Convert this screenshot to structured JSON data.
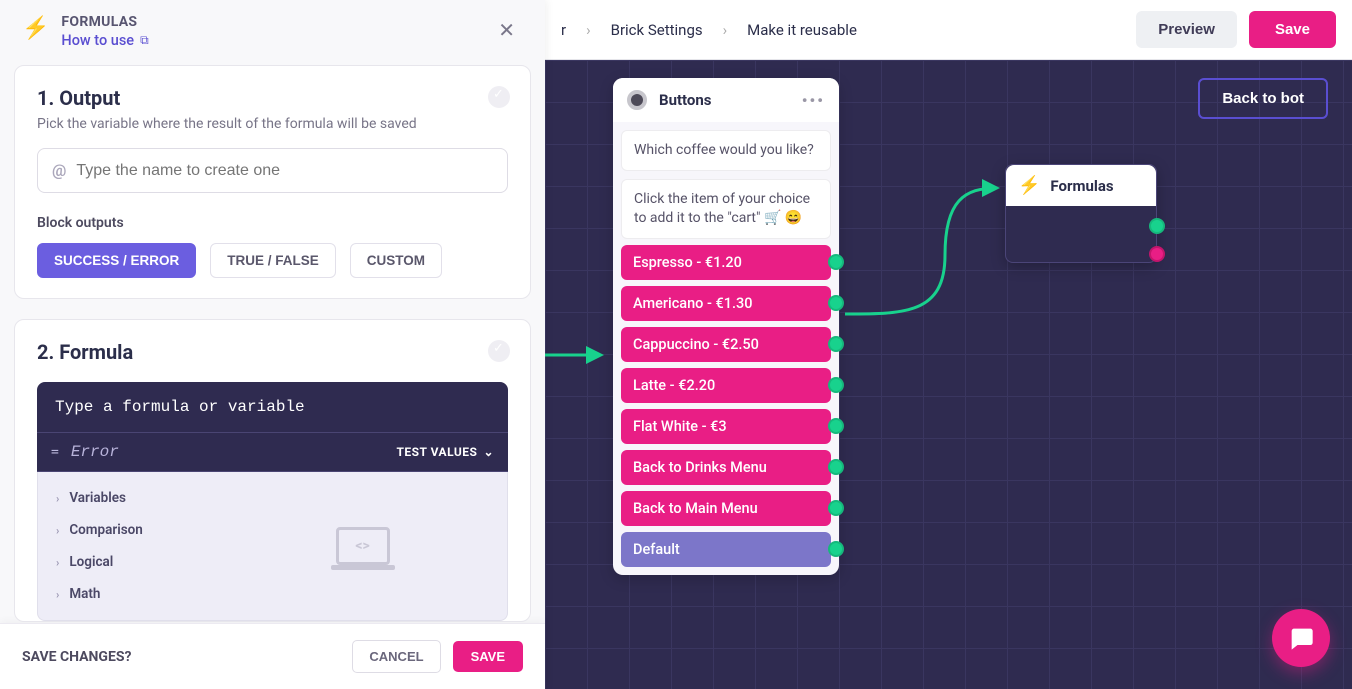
{
  "topbar": {
    "breadcrumb": [
      "r",
      "Brick Settings",
      "Make it reusable"
    ],
    "preview": "Preview",
    "save": "Save"
  },
  "canvas": {
    "back_to_bot": "Back to bot",
    "buttons_node": {
      "title": "Buttons",
      "msg1": "Which coffee would you like?",
      "msg2": "Click the item of your choice to add it to the \"cart\" 🛒 😄",
      "options": [
        "Espresso - €1.20",
        "Americano - €1.30",
        "Cappuccino - €2.50",
        "Latte - €2.20",
        "Flat White - €3",
        "Back to Drinks Menu",
        "Back to Main Menu"
      ],
      "default_label": "Default"
    },
    "formulas_node": {
      "title": "Formulas"
    }
  },
  "panel": {
    "title": "FORMULAS",
    "how_to_use": "How to use",
    "sections": {
      "output": {
        "heading": "1. Output",
        "sub": "Pick the variable where the result of the formula will be saved",
        "placeholder": "Type the name to create one",
        "at": "@",
        "block_outputs_label": "Block outputs",
        "pills": [
          "SUCCESS / ERROR",
          "TRUE / FALSE",
          "CUSTOM"
        ],
        "selected_pill": 0
      },
      "formula": {
        "heading": "2. Formula",
        "head_text": "Type a formula or variable",
        "equals": "=",
        "error": "Error",
        "test_values": "TEST VALUES",
        "categories": [
          "Variables",
          "Comparison",
          "Logical",
          "Math"
        ]
      }
    },
    "footer": {
      "question": "SAVE CHANGES?",
      "cancel": "CANCEL",
      "save": "SAVE"
    }
  }
}
